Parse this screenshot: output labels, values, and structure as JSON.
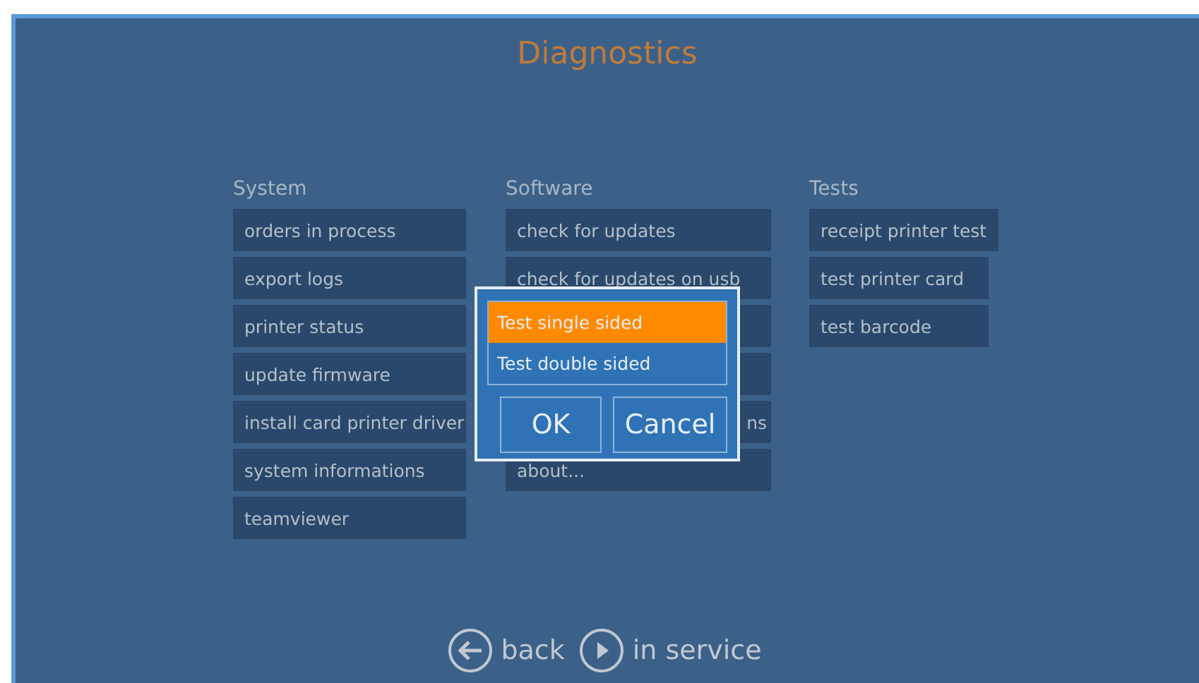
{
  "title": "Diagnostics",
  "sections": [
    {
      "heading": "System",
      "items": [
        {
          "label": "orders in process"
        },
        {
          "label": "export logs"
        },
        {
          "label": "printer status"
        },
        {
          "label": "update firmware"
        },
        {
          "label": "install card printer driver"
        },
        {
          "label": "system informations"
        },
        {
          "label": "teamviewer"
        }
      ]
    },
    {
      "heading": "Software",
      "items": [
        {
          "label": "check for updates"
        },
        {
          "label": "check for updates on usb"
        },
        {
          "kind": "covered"
        },
        {
          "kind": "covered"
        },
        {
          "kind": "cut",
          "label": "ns"
        },
        {
          "label": "about..."
        }
      ]
    },
    {
      "heading": "Tests",
      "items": [
        {
          "label": "receipt printer test"
        },
        {
          "label": "test printer card"
        },
        {
          "label": "test barcode"
        }
      ]
    }
  ],
  "dialog": {
    "options": [
      {
        "label": "Test single sided",
        "selected": true
      },
      {
        "label": "Test double sided",
        "selected": false
      }
    ],
    "buttons": [
      "OK",
      "Cancel"
    ]
  },
  "nav": [
    {
      "kind": "back",
      "label": "back"
    },
    {
      "kind": "play",
      "label": "in service"
    }
  ]
}
